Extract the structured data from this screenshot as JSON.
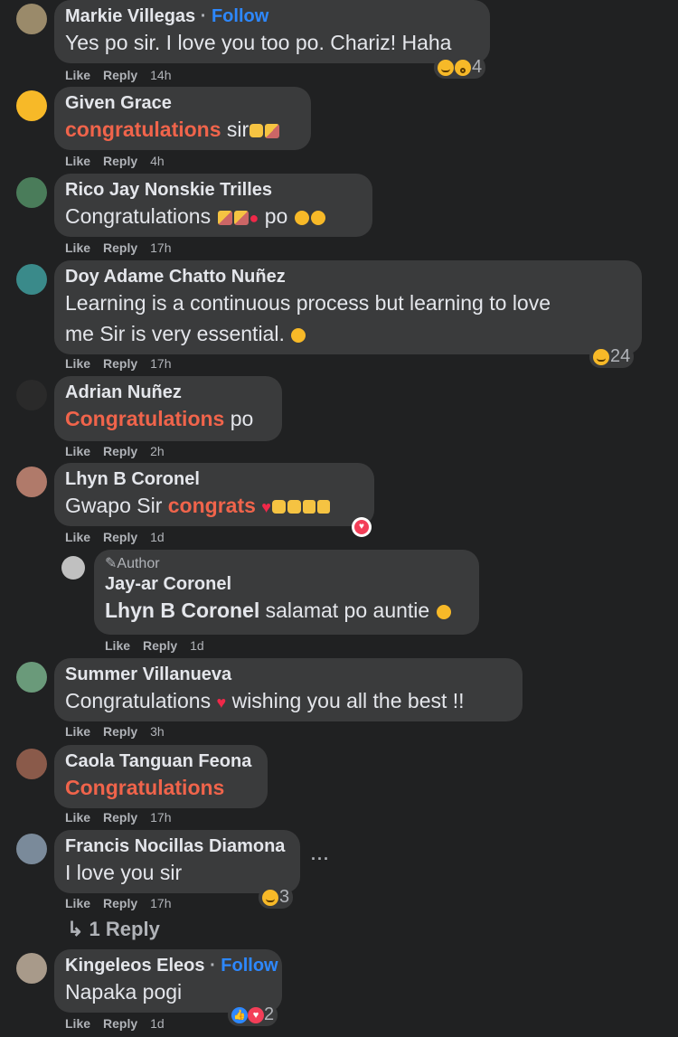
{
  "comments": [
    {
      "name": "Markie Villegas",
      "follow": "Follow",
      "text": "Yes po sir. I love you too po. Chariz! Haha",
      "like": "Like",
      "reply": "Reply",
      "time": "14h",
      "reaction_count": "4"
    },
    {
      "name": "Given Grace",
      "text_hl": "congratulations",
      "text_rest": " sir",
      "like": "Like",
      "reply": "Reply",
      "time": "4h"
    },
    {
      "name": "Rico Jay Nonskie Trilles",
      "text": "Congratulations",
      "text_after": " po",
      "like": "Like",
      "reply": "Reply",
      "time": "17h"
    },
    {
      "name": "Doy Adame Chatto Nuñez",
      "text_line1": "Learning is a continuous process but learning to love",
      "text_line2": "me Sir is very essential.",
      "like": "Like",
      "reply": "Reply",
      "time": "17h",
      "reaction_count": "24"
    },
    {
      "name": "Adrian Nuñez",
      "text_hl": "Congratulations",
      "text_rest": " po",
      "like": "Like",
      "reply": "Reply",
      "time": "2h"
    },
    {
      "name": "Lhyn B Coronel",
      "text_pre": "Gwapo Sir ",
      "text_hl": "congrats",
      "like": "Like",
      "reply": "Reply",
      "time": "1d"
    },
    {
      "author_badge": "Author",
      "name": "Jay-ar Coronel",
      "mention": "Lhyn B Coronel",
      "text_rest": " salamat po auntie",
      "like": "Like",
      "reply": "Reply",
      "time": "1d"
    },
    {
      "name": "Summer Villanueva",
      "text_pre": "Congratulations ",
      "text_rest": " wishing you all the best !!",
      "like": "Like",
      "reply": "Reply",
      "time": "3h"
    },
    {
      "name": "Caola Tanguan Feona",
      "text_hl": "Congratulations",
      "like": "Like",
      "reply": "Reply",
      "time": "17h"
    },
    {
      "name": "Francis Nocillas Diamona",
      "text": "I love you sir",
      "like": "Like",
      "reply": "Reply",
      "time": "17h",
      "reaction_count": "3",
      "more": "···",
      "replies_link": "↳ 1 Reply"
    },
    {
      "name": "Kingeleos Eleos",
      "follow": "Follow",
      "text": "Napaka pogi",
      "like": "Like",
      "reply": "Reply",
      "time": "1d",
      "reaction_count": "2"
    }
  ],
  "colors": {
    "background": "#202122",
    "bubble": "#3a3b3c",
    "highlight": "#f0644b",
    "follow": "#2d88ff"
  }
}
